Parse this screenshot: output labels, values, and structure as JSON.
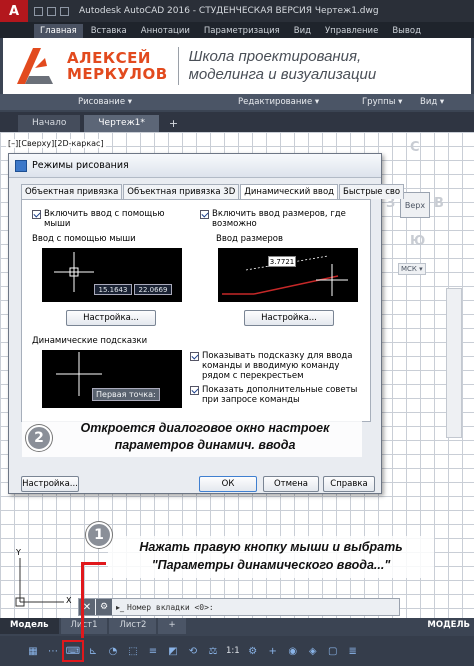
{
  "title_bar": {
    "logo_letter": "A",
    "window_title": "Autodesk AutoCAD 2016 - СТУДЕНЧЕСКАЯ ВЕРСИЯ    Чертеж1.dwg"
  },
  "ribbon_tabs": [
    "Главная",
    "Вставка",
    "Аннотации",
    "Параметризация",
    "Вид",
    "Управление",
    "Вывод"
  ],
  "banner": {
    "name_line1": "АЛЕКСЕЙ",
    "name_line2": "МЕРКУЛОВ",
    "school_line1": "Школа проектирования,",
    "school_line2": "моделинга и визуализации"
  },
  "ribbon_panels": {
    "draw": "Рисование ▾",
    "modify": "Редактирование ▾",
    "groups": "Группы ▾",
    "view": "Вид ▾"
  },
  "doc_tabs": {
    "start": "Начало",
    "drawing": "Чертеж1*",
    "add": "+"
  },
  "viewport_label": "[–][Сверху][2D-каркас]",
  "viewcube": {
    "face": "Верх",
    "north": "С",
    "west": "З",
    "east": "В",
    "south": "Ю",
    "wcs": "МСК ▾"
  },
  "dialog": {
    "title": "Режимы рисования",
    "tabs": [
      "Объектная привязка",
      "Объектная привязка 3D",
      "Динамический ввод",
      "Быстрые сво"
    ],
    "active_tab": 2,
    "enable_pointer_input": "Включить ввод с помощью мыши",
    "enable_dim_input": "Включить ввод размеров, где возможно",
    "pointer_input_label": "Ввод с помощью мыши",
    "dim_input_label": "Ввод размеров",
    "pointer_x": "15.1643",
    "pointer_y": "22.0669",
    "dim_value": "3.7721",
    "settings_btn_1": "Настройка...",
    "settings_btn_2": "Настройка...",
    "dynamic_prompts_label": "Динамические подсказки",
    "prompt_text": "Первая точка:",
    "show_prompts": "Показывать подсказку для ввода команды и вводимую команду рядом с перекрестьем",
    "show_tooltips": "Показать дополнительные советы при запросе команды",
    "options_btn": "Настройка...",
    "ok_btn": "ОК",
    "cancel_btn": "Отмена",
    "help_btn": "Справка"
  },
  "annotation_step2": {
    "number": "2",
    "text": "Откроется диалоговое окно настроек параметров динамич. ввода"
  },
  "annotation_step1": {
    "number": "1",
    "text": "Нажать правую кнопку мыши и выбрать \"Параметры динамического ввода...\""
  },
  "ucs": {
    "x": "X",
    "y": "Y"
  },
  "command_line": {
    "prompt_icon": "▸_",
    "placeholder": "Номер вкладки <0>:"
  },
  "layout_tabs": [
    "Модель",
    "Лист1",
    "Лист2",
    "+"
  ],
  "model_indicator": "МОДЕЛЬ",
  "status_bar": {
    "scale": "1:1"
  },
  "colors": {
    "accent_red": "#e0181c",
    "brand_orange": "#e24a1e",
    "dialog_bg": "#e9ecf1"
  }
}
